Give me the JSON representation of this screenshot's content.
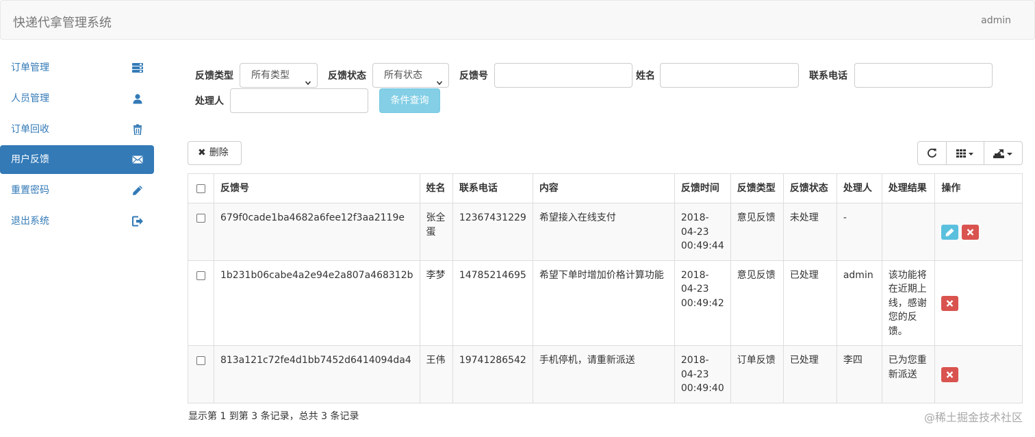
{
  "header": {
    "title": "快递代拿管理系统",
    "user": "admin"
  },
  "sidebar": {
    "items": [
      {
        "label": "订单管理",
        "icon": "tasks-icon",
        "active": false
      },
      {
        "label": "人员管理",
        "icon": "user-icon",
        "active": false
      },
      {
        "label": "订单回收",
        "icon": "trash-icon",
        "active": false
      },
      {
        "label": "用户反馈",
        "icon": "envelope-icon",
        "active": true
      },
      {
        "label": "重置密码",
        "icon": "pencil-icon",
        "active": false
      },
      {
        "label": "退出系统",
        "icon": "logout-icon",
        "active": false
      }
    ]
  },
  "filters": {
    "type_label": "反馈类型",
    "type_value": "所有类型",
    "status_label": "反馈状态",
    "status_value": "所有状态",
    "id_label": "反馈号",
    "id_value": "",
    "name_label": "姓名",
    "name_value": "",
    "phone_label": "联系电话",
    "phone_value": "",
    "handler_label": "处理人",
    "handler_value": "",
    "query_button": "条件查询"
  },
  "toolbar": {
    "delete_label": "删除"
  },
  "table": {
    "columns": [
      "反馈号",
      "姓名",
      "联系电话",
      "内容",
      "反馈时间",
      "反馈类型",
      "反馈状态",
      "处理人",
      "处理结果",
      "操作"
    ],
    "rows": [
      {
        "id": "679f0cade1ba4682a6fee12f3aa2119e",
        "name": "张全蛋",
        "phone": "12367431229",
        "content": "希望接入在线支付",
        "time": "2018-04-23 00:49:44",
        "type": "意见反馈",
        "status": "未处理",
        "handler": "-",
        "result": "",
        "editable": true
      },
      {
        "id": "1b231b06cabe4a2e94e2a807a468312b",
        "name": "李梦",
        "phone": "14785214695",
        "content": "希望下单时增加价格计算功能",
        "time": "2018-04-23 00:49:42",
        "type": "意见反馈",
        "status": "已处理",
        "handler": "admin",
        "result": "该功能将在近期上线，感谢您的反馈。",
        "editable": false
      },
      {
        "id": "813a121c72fe4d1bb7452d6414094da4",
        "name": "王伟",
        "phone": "19741286542",
        "content": "手机停机，请重新派送",
        "time": "2018-04-23 00:49:40",
        "type": "订单反馈",
        "status": "已处理",
        "handler": "李四",
        "result": "已为您重新派送",
        "editable": false
      }
    ]
  },
  "footer": {
    "pagination_info": "显示第 1 到第 3 条记录，总共 3 条记录",
    "watermark": "@稀土掘金技术社区"
  },
  "colors": {
    "primary": "#337ab7",
    "info": "#5bc0de",
    "danger": "#d9534f"
  }
}
